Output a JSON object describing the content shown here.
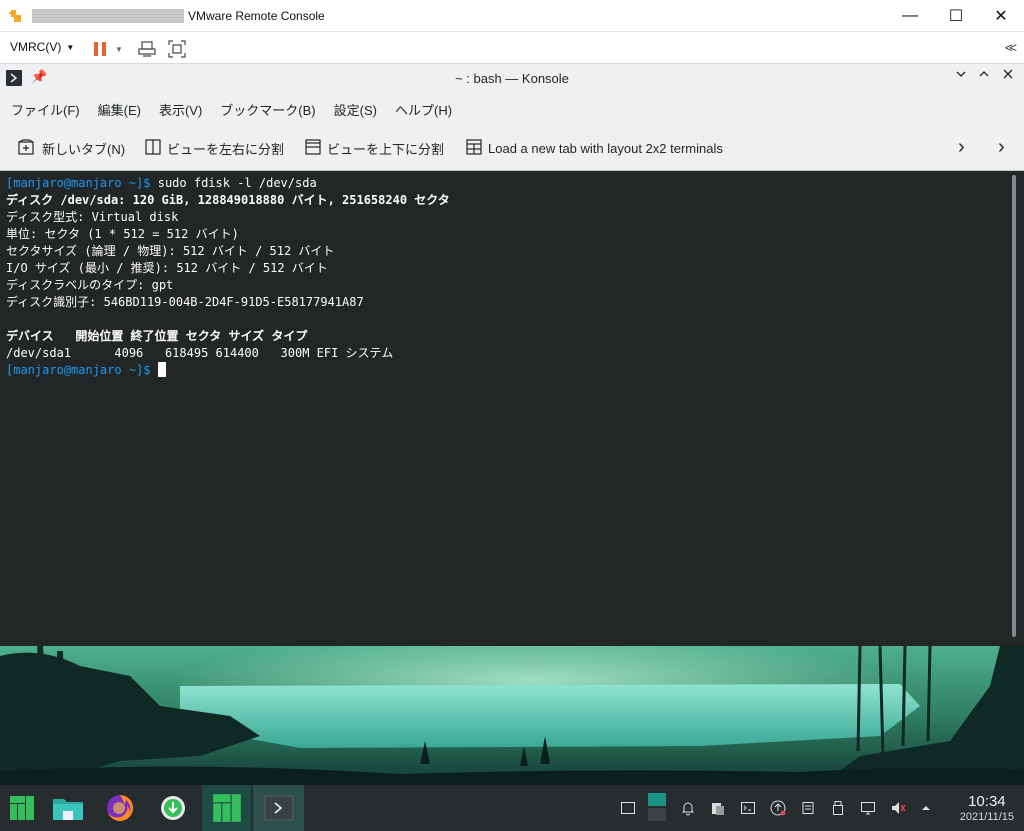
{
  "window": {
    "title": "VMware Remote Console",
    "controls": {
      "minimize": "—",
      "maximize": "☐",
      "close": "✕"
    }
  },
  "vmrc": {
    "menu_label": "VMRC(V)",
    "collapse_label": "<<"
  },
  "konsole": {
    "title": "~ : bash — Konsole",
    "menu": [
      "ファイル(F)",
      "編集(E)",
      "表示(V)",
      "ブックマーク(B)",
      "設定(S)",
      "ヘルプ(H)"
    ],
    "toolbar": {
      "new_tab": "新しいタブ(N)",
      "split_lr": "ビューを左右に分割",
      "split_tb": "ビューを上下に分割",
      "layout_2x2": "Load a new tab with layout 2x2 terminals"
    }
  },
  "terminal": {
    "prompt": "[manjaro@manjaro ~]$",
    "command": " sudo fdisk -l /dev/sda",
    "lines": [
      "ディスク /dev/sda: 120 GiB, 128849018880 バイト, 251658240 セクタ",
      "ディスク型式: Virtual disk",
      "単位: セクタ (1 * 512 = 512 バイト)",
      "セクタサイズ (論理 / 物理): 512 バイト / 512 バイト",
      "I/O サイズ (最小 / 推奨): 512 バイト / 512 バイト",
      "ディスクラベルのタイプ: gpt",
      "ディスク識別子: 546BD119-004B-2D4F-91D5-E58177941A87",
      "",
      "デバイス   開始位置 終了位置 セクタ サイズ タイプ",
      "/dev/sda1      4096   618495 614400   300M EFI システム"
    ],
    "prompt2": "[manjaro@manjaro ~]$"
  },
  "taskbar": {
    "time": "10:34",
    "date": "2021/11/15",
    "apps": [
      "manjaro-menu-icon",
      "file-manager-icon",
      "firefox-icon",
      "update-icon",
      "manjaro-icon",
      "konsole-icon"
    ]
  },
  "colors": {
    "terminal_bg": "#232627",
    "prompt": "#1d99f3",
    "taskbar_bg": "#272c2e",
    "accent": "#16a085"
  }
}
